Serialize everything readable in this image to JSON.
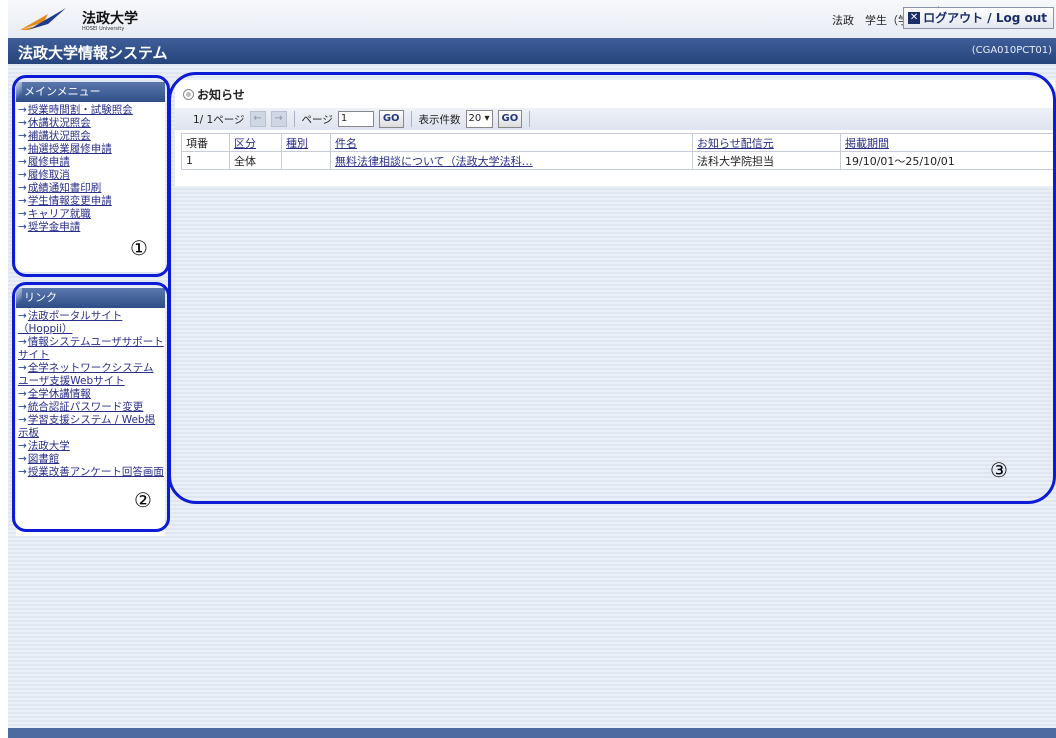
{
  "header": {
    "logo_text": "法政大学",
    "logo_sub": "HOSEI University",
    "user_label": "法政　学生（学生）",
    "logout_label": "ログアウト / Log out"
  },
  "titlebar": {
    "title": "法政大学情報システム",
    "code": "(CGA010PCT01)"
  },
  "main_menu": {
    "heading": "メインメニュー",
    "items": [
      "授業時間割・試験照会",
      "休講状況照会",
      "補講状況照会",
      "抽選授業履修申請",
      "履修申請",
      "履修取消",
      "成績通知書印刷",
      "学生情報変更申請",
      "キャリア就職",
      "奨学金申請"
    ]
  },
  "links": {
    "heading": "リンク",
    "items": [
      "法政ポータルサイト\n（Hoppii）",
      "情報システムユーザサポートサイト",
      "全学ネットワークシステム ユーザ支援Webサイト",
      "全学休講情報",
      "統合認証パスワード変更",
      "学習支援システム / Web掲示板",
      "法政大学",
      "図書館",
      "授業改善アンケート回答画面"
    ]
  },
  "notices": {
    "title": "お知らせ",
    "pager": {
      "page_info": "1/ 1ページ",
      "page_label": "ページ",
      "page_value": "1",
      "go_label": "GO",
      "per_page_label": "表示件数",
      "per_page_value": "20"
    },
    "columns": [
      "項番",
      "区分",
      "種別",
      "件名",
      "お知らせ配信元",
      "掲載期間"
    ],
    "rows": [
      [
        "1",
        "全体",
        "",
        "無料法律相談について（法政大学法科…",
        "法科大学院担当",
        "19/10/01～25/10/01"
      ]
    ]
  },
  "annotations": {
    "label_1": "①",
    "label_2": "②",
    "label_3": "③"
  },
  "colors": {
    "annotation_blue": "#0b1bd6",
    "titlebar_blue": "#26447c",
    "link_color": "#2a2f8a"
  }
}
